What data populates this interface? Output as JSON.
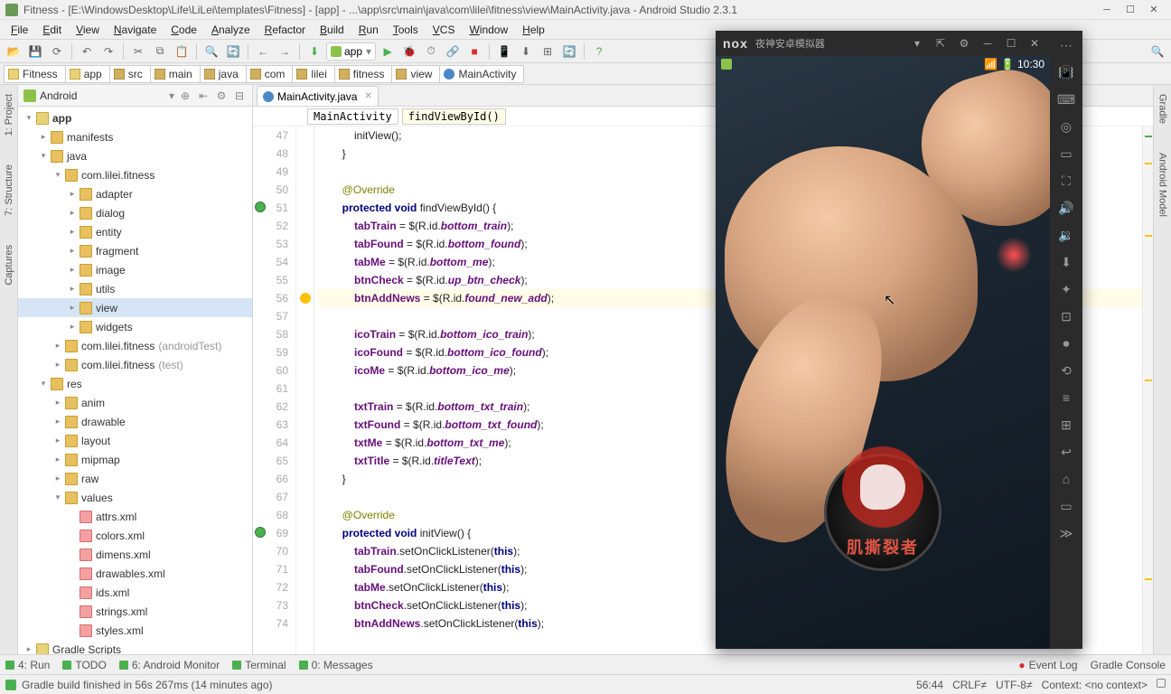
{
  "title": "Fitness - [E:\\WindowsDesktop\\Life\\LiLei\\templates\\Fitness] - [app] - ...\\app\\src\\main\\java\\com\\lilei\\fitness\\view\\MainActivity.java - Android Studio 2.3.1",
  "menu": [
    "File",
    "Edit",
    "View",
    "Navigate",
    "Code",
    "Analyze",
    "Refactor",
    "Build",
    "Run",
    "Tools",
    "VCS",
    "Window",
    "Help"
  ],
  "runconfig": "app",
  "crumbs": [
    {
      "label": "Fitness",
      "type": "mod"
    },
    {
      "label": "app",
      "type": "mod"
    },
    {
      "label": "src",
      "type": "fold"
    },
    {
      "label": "main",
      "type": "fold"
    },
    {
      "label": "java",
      "type": "fold"
    },
    {
      "label": "com",
      "type": "fold"
    },
    {
      "label": "lilei",
      "type": "fold"
    },
    {
      "label": "fitness",
      "type": "fold"
    },
    {
      "label": "view",
      "type": "fold"
    },
    {
      "label": "MainActivity",
      "type": "cls"
    }
  ],
  "leftTabs": [
    "1: Project",
    "7: Structure",
    "Captures"
  ],
  "rightTabs": [
    "Gradle",
    "Android Model"
  ],
  "projectHeader": "Android",
  "tree": [
    {
      "d": 0,
      "exp": "▾",
      "ic": "mod",
      "label": "app",
      "bold": true
    },
    {
      "d": 1,
      "exp": "▸",
      "ic": "fold",
      "label": "manifests"
    },
    {
      "d": 1,
      "exp": "▾",
      "ic": "fold",
      "label": "java"
    },
    {
      "d": 2,
      "exp": "▾",
      "ic": "fold",
      "label": "com.lilei.fitness"
    },
    {
      "d": 3,
      "exp": "▸",
      "ic": "fold",
      "label": "adapter"
    },
    {
      "d": 3,
      "exp": "▸",
      "ic": "fold",
      "label": "dialog"
    },
    {
      "d": 3,
      "exp": "▸",
      "ic": "fold",
      "label": "entity"
    },
    {
      "d": 3,
      "exp": "▸",
      "ic": "fold",
      "label": "fragment"
    },
    {
      "d": 3,
      "exp": "▸",
      "ic": "fold",
      "label": "image"
    },
    {
      "d": 3,
      "exp": "▸",
      "ic": "fold",
      "label": "utils"
    },
    {
      "d": 3,
      "exp": "▸",
      "ic": "fold",
      "label": "view",
      "sel": true
    },
    {
      "d": 3,
      "exp": "▸",
      "ic": "fold",
      "label": "widgets"
    },
    {
      "d": 2,
      "exp": "▸",
      "ic": "fold",
      "label": "com.lilei.fitness",
      "muted": "(androidTest)"
    },
    {
      "d": 2,
      "exp": "▸",
      "ic": "fold",
      "label": "com.lilei.fitness",
      "muted": "(test)"
    },
    {
      "d": 1,
      "exp": "▾",
      "ic": "fold",
      "label": "res"
    },
    {
      "d": 2,
      "exp": "▸",
      "ic": "fold",
      "label": "anim"
    },
    {
      "d": 2,
      "exp": "▸",
      "ic": "fold",
      "label": "drawable"
    },
    {
      "d": 2,
      "exp": "▸",
      "ic": "fold",
      "label": "layout"
    },
    {
      "d": 2,
      "exp": "▸",
      "ic": "fold",
      "label": "mipmap"
    },
    {
      "d": 2,
      "exp": "▸",
      "ic": "fold",
      "label": "raw"
    },
    {
      "d": 2,
      "exp": "▾",
      "ic": "fold",
      "label": "values"
    },
    {
      "d": 3,
      "exp": "",
      "ic": "xml",
      "label": "attrs.xml"
    },
    {
      "d": 3,
      "exp": "",
      "ic": "xml",
      "label": "colors.xml"
    },
    {
      "d": 3,
      "exp": "",
      "ic": "xml",
      "label": "dimens.xml"
    },
    {
      "d": 3,
      "exp": "",
      "ic": "xml",
      "label": "drawables.xml"
    },
    {
      "d": 3,
      "exp": "",
      "ic": "xml",
      "label": "ids.xml"
    },
    {
      "d": 3,
      "exp": "",
      "ic": "xml",
      "label": "strings.xml"
    },
    {
      "d": 3,
      "exp": "",
      "ic": "xml",
      "label": "styles.xml"
    },
    {
      "d": 0,
      "exp": "▸",
      "ic": "mod",
      "label": "Gradle Scripts"
    }
  ],
  "editorTab": {
    "label": "MainActivity.java"
  },
  "breadcrumb": [
    {
      "label": "MainActivity",
      "hl": false
    },
    {
      "label": "findViewById()",
      "hl": true
    }
  ],
  "code": {
    "startLine": 47,
    "lines": [
      {
        "n": 47,
        "html": "            initView();"
      },
      {
        "n": 48,
        "html": "        }"
      },
      {
        "n": 49,
        "html": ""
      },
      {
        "n": 50,
        "html": "        <span class='ann'>@Override</span>"
      },
      {
        "n": 51,
        "ovr": true,
        "html": "        <span class='kw'>protected void</span> findViewById() {"
      },
      {
        "n": 52,
        "html": "            <span class='fld'>tabTrain</span> = $(R.id.<span class='id2'>bottom_train</span>);"
      },
      {
        "n": 53,
        "html": "            <span class='fld'>tabFound</span> = $(R.id.<span class='id2'>bottom_found</span>);"
      },
      {
        "n": 54,
        "html": "            <span class='fld'>tabMe</span> = $(R.id.<span class='id2'>bottom_me</span>);"
      },
      {
        "n": 55,
        "html": "            <span class='fld'>btnCheck</span> = $(R.id.<span class='id2'>up_btn_check</span>);"
      },
      {
        "n": 56,
        "hilite": true,
        "bulb": true,
        "html": "            <span class='fld'>btnAddNews</span> = $(R.id.<span class='id2'>found_new_add</span>);"
      },
      {
        "n": 57,
        "html": ""
      },
      {
        "n": 58,
        "html": "            <span class='fld'>icoTrain</span> = $(R.id.<span class='id2'>bottom_ico_train</span>);"
      },
      {
        "n": 59,
        "html": "            <span class='fld'>icoFound</span> = $(R.id.<span class='id2'>bottom_ico_found</span>);"
      },
      {
        "n": 60,
        "html": "            <span class='fld'>icoMe</span> = $(R.id.<span class='id2'>bottom_ico_me</span>);"
      },
      {
        "n": 61,
        "html": ""
      },
      {
        "n": 62,
        "html": "            <span class='fld'>txtTrain</span> = $(R.id.<span class='id2'>bottom_txt_train</span>);"
      },
      {
        "n": 63,
        "html": "            <span class='fld'>txtFound</span> = $(R.id.<span class='id2'>bottom_txt_found</span>);"
      },
      {
        "n": 64,
        "html": "            <span class='fld'>txtMe</span> = $(R.id.<span class='id2'>bottom_txt_me</span>);"
      },
      {
        "n": 65,
        "html": "            <span class='fld'>txtTitle</span> = $(R.id.<span class='id2'>titleText</span>);"
      },
      {
        "n": 66,
        "html": "        }"
      },
      {
        "n": 67,
        "html": ""
      },
      {
        "n": 68,
        "html": "        <span class='ann'>@Override</span>"
      },
      {
        "n": 69,
        "ovr": true,
        "html": "        <span class='kw'>protected void</span> initView() {"
      },
      {
        "n": 70,
        "html": "            <span class='fld'>tabTrain</span>.setOnClickListener(<span class='kw'>this</span>);"
      },
      {
        "n": 71,
        "html": "            <span class='fld'>tabFound</span>.setOnClickListener(<span class='kw'>this</span>);"
      },
      {
        "n": 72,
        "html": "            <span class='fld'>tabMe</span>.setOnClickListener(<span class='kw'>this</span>);"
      },
      {
        "n": 73,
        "html": "            <span class='fld'>btnCheck</span>.setOnClickListener(<span class='kw'>this</span>);"
      },
      {
        "n": 74,
        "html": "            <span class='fld'>btnAddNews</span>.setOnClickListener(<span class='kw'>this</span>);"
      }
    ]
  },
  "emulator": {
    "title": "夜神安卓模拟器",
    "clock": "10:30",
    "logoText": "肌撕裂者"
  },
  "bottomTools": [
    "4: Run",
    "TODO",
    "6: Android Monitor",
    "Terminal",
    "0: Messages"
  ],
  "bottomRight": [
    "Event Log",
    "Gradle Console"
  ],
  "statusMsg": "Gradle build finished in 56s 267ms (14 minutes ago)",
  "statusRight": [
    "56:44",
    "CRLF≠",
    "UTF-8≠",
    "Context: <no context>"
  ]
}
